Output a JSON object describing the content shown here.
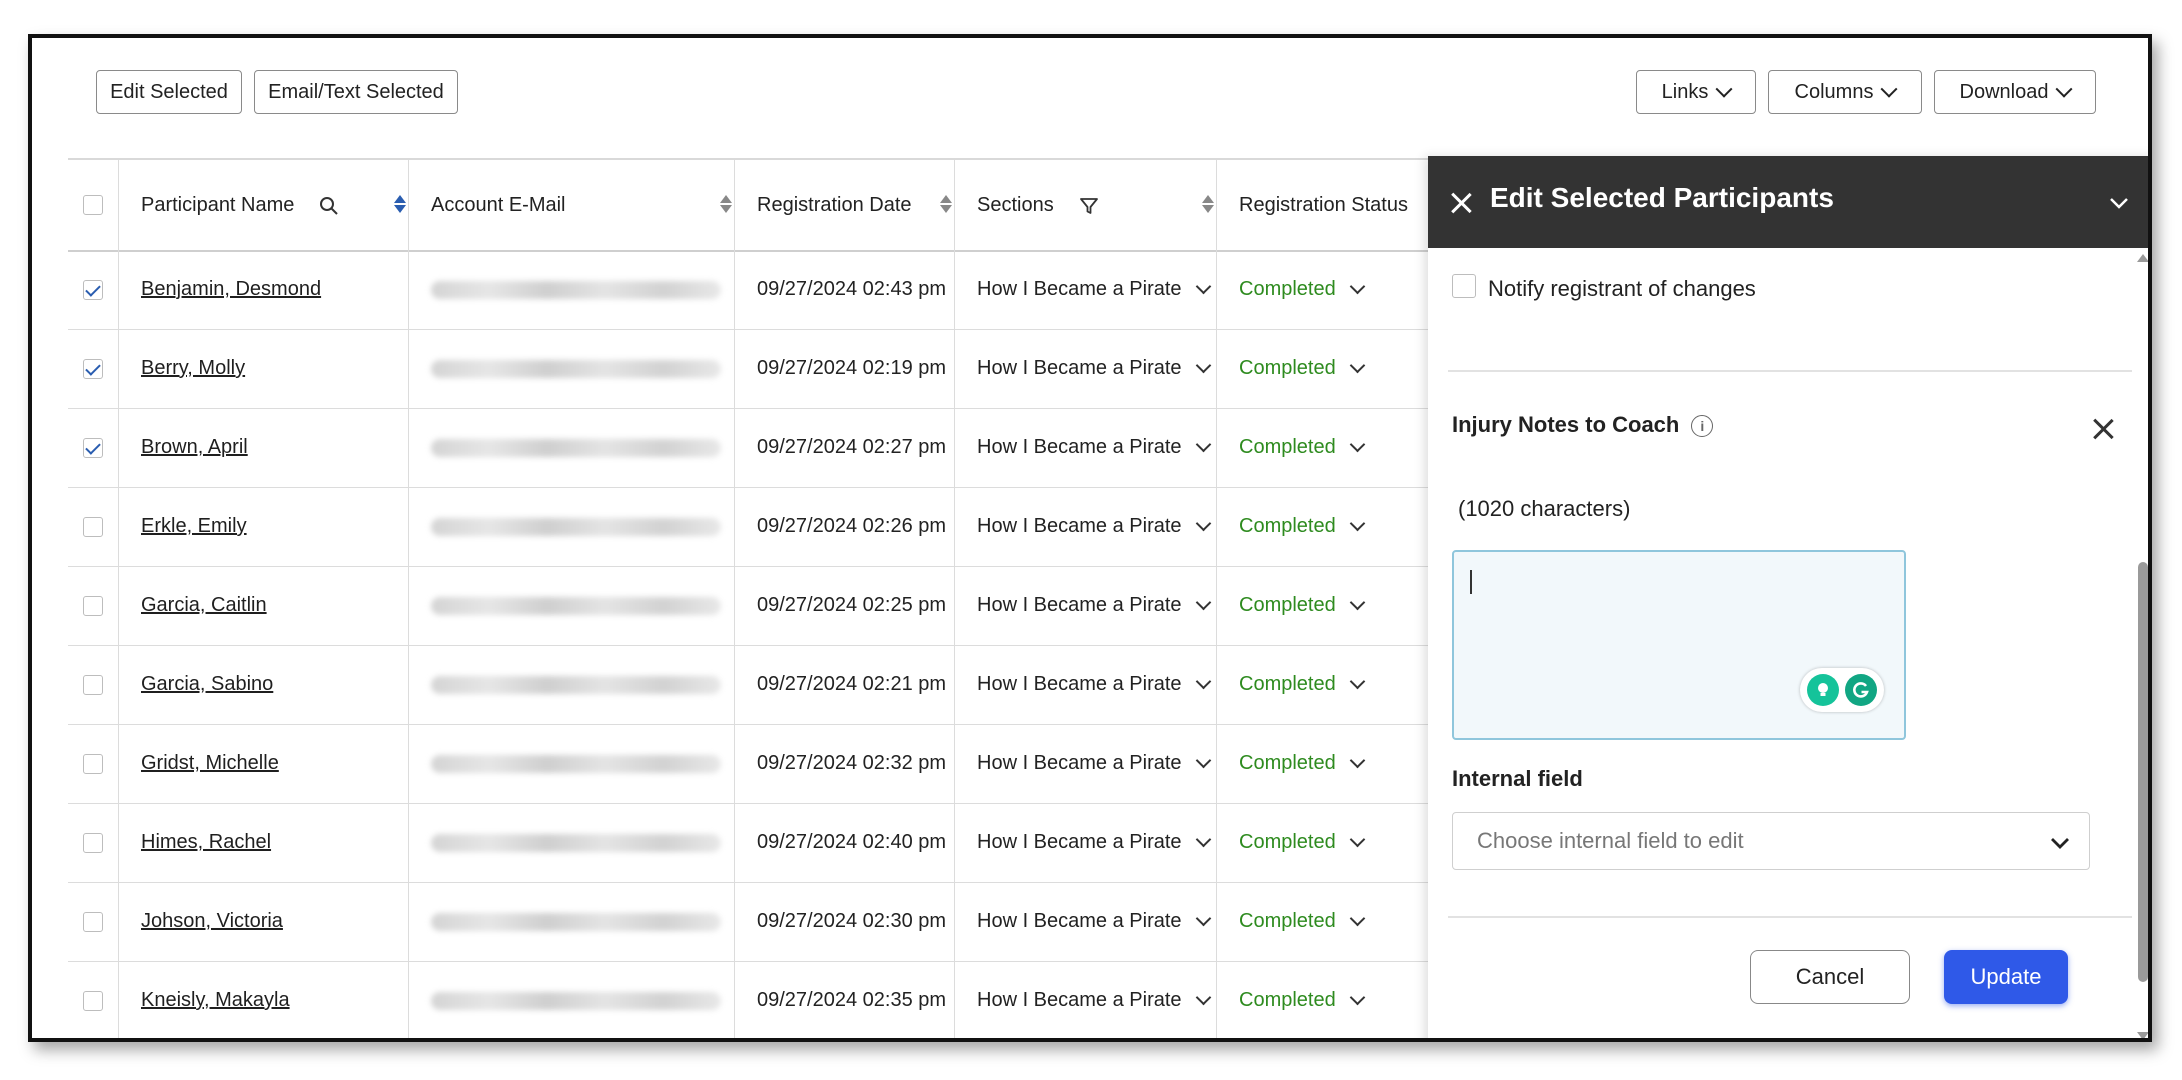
{
  "toolbar": {
    "edit_selected": "Edit Selected",
    "email_text_selected": "Email/Text Selected",
    "links": "Links",
    "columns": "Columns",
    "download": "Download"
  },
  "table": {
    "headers": [
      "Participant Name",
      "Account E-Mail",
      "Registration Date",
      "Sections",
      "Registration Status"
    ],
    "rows": [
      {
        "name": "Benjamin, Desmond",
        "date": "09/27/2024 02:43 pm",
        "section": "How I Became a Pirate",
        "status": "Completed",
        "checked": true
      },
      {
        "name": "Berry, Molly",
        "date": "09/27/2024 02:19 pm",
        "section": "How I Became a Pirate",
        "status": "Completed",
        "checked": true
      },
      {
        "name": "Brown, April",
        "date": "09/27/2024 02:27 pm",
        "section": "How I Became a Pirate",
        "status": "Completed",
        "checked": true
      },
      {
        "name": "Erkle, Emily",
        "date": "09/27/2024 02:26 pm",
        "section": "How I Became a Pirate",
        "status": "Completed",
        "checked": false
      },
      {
        "name": "Garcia, Caitlin",
        "date": "09/27/2024 02:25 pm",
        "section": "How I Became a Pirate",
        "status": "Completed",
        "checked": false
      },
      {
        "name": "Garcia, Sabino",
        "date": "09/27/2024 02:21 pm",
        "section": "How I Became a Pirate",
        "status": "Completed",
        "checked": false
      },
      {
        "name": "Gridst, Michelle",
        "date": "09/27/2024 02:32 pm",
        "section": "How I Became a Pirate",
        "status": "Completed",
        "checked": false
      },
      {
        "name": "Himes, Rachel",
        "date": "09/27/2024 02:40 pm",
        "section": "How I Became a Pirate",
        "status": "Completed",
        "checked": false
      },
      {
        "name": "Johson, Victoria",
        "date": "09/27/2024 02:30 pm",
        "section": "How I Became a Pirate",
        "status": "Completed",
        "checked": false
      },
      {
        "name": "Kneisly, Makayla",
        "date": "09/27/2024 02:35 pm",
        "section": "How I Became a Pirate",
        "status": "Completed",
        "checked": false
      }
    ]
  },
  "panel": {
    "title": "Edit Selected Participants",
    "notify_label": "Notify registrant of changes",
    "injury_notes_label": "Injury Notes to Coach",
    "char_count": "(1020 characters)",
    "internal_field_label": "Internal field",
    "internal_field_placeholder": "Choose internal field to edit",
    "cancel": "Cancel",
    "update": "Update"
  },
  "colors": {
    "panel_header": "#333333",
    "status_green": "#2e8b1f",
    "update_blue": "#2f59e8",
    "sort_active": "#2a5db0"
  }
}
